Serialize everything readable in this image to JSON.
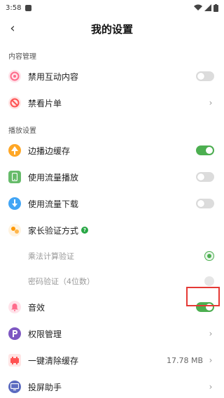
{
  "status_bar": {
    "time": "3:58"
  },
  "header": {
    "title": "我的设置"
  },
  "sections": {
    "content": {
      "title": "内容管理",
      "disable_interactive": {
        "label": "禁用互动内容",
        "enabled": false,
        "icon": "interactive-ban-icon",
        "color": "#ff6b8b"
      },
      "blocked_list": {
        "label": "禁看片单",
        "icon": "ban-list-icon",
        "color": "#ff5252"
      }
    },
    "playback": {
      "title": "播放设置",
      "play_while_cache": {
        "label": "边播边缓存",
        "enabled": true,
        "icon": "cache-icon",
        "color": "#ffa726"
      },
      "mobile_data_play": {
        "label": "使用流量播放",
        "enabled": false,
        "icon": "phone-icon",
        "color": "#66bb6a"
      },
      "mobile_data_download": {
        "label": "使用流量下载",
        "enabled": false,
        "icon": "download-icon",
        "color": "#42a5f5"
      },
      "parental_verify": {
        "label": "家长验证方式",
        "icon": "parent-verify-icon",
        "color": "#ff9800",
        "options": [
          {
            "label": "乘法计算验证",
            "selected": true
          },
          {
            "label": "密码验证（4位数）",
            "selected": false
          }
        ]
      },
      "sound_effects": {
        "label": "音效",
        "enabled": true,
        "icon": "bell-icon",
        "color": "#ff6b8b"
      },
      "permissions": {
        "label": "权限管理",
        "icon": "p-icon",
        "color": "#7e57c2"
      },
      "clear_cache": {
        "label": "一键清除缓存",
        "value": "17.78 MB",
        "icon": "cache-clear-icon",
        "color": "#ff5252"
      },
      "cast_helper": {
        "label": "投屏助手",
        "icon": "tv-icon",
        "color": "#5c6bc0"
      }
    }
  },
  "colors": {
    "toggle_on": "#4caf50",
    "highlight": "#e53935"
  }
}
